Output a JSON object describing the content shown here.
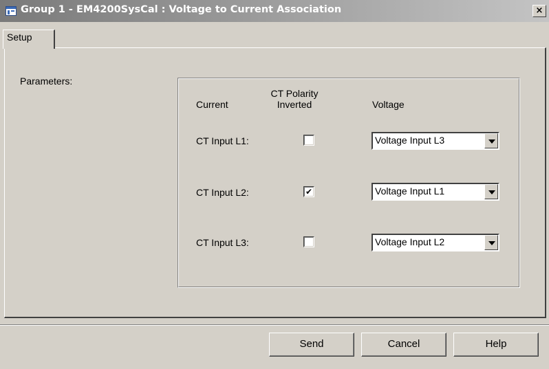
{
  "window": {
    "title": "Group 1 - EM4200SysCal : Voltage to Current Association",
    "close_glyph": "×",
    "app_icon": "app-window-icon"
  },
  "tabs": [
    {
      "label": "Setup",
      "selected": true
    }
  ],
  "parameters_label": "Parameters:",
  "table": {
    "headers": {
      "current": "Current",
      "polarity": "CT Polarity Inverted",
      "voltage": "Voltage"
    },
    "rows": [
      {
        "label": "CT Input L1:",
        "inverted": false,
        "voltage": "Voltage Input L3"
      },
      {
        "label": "CT Input L2:",
        "inverted": true,
        "voltage": "Voltage Input L1"
      },
      {
        "label": "CT Input L3:",
        "inverted": false,
        "voltage": "Voltage Input L2"
      }
    ],
    "check_glyph": "✔"
  },
  "buttons": {
    "send": "Send",
    "cancel": "Cancel",
    "help": "Help"
  }
}
